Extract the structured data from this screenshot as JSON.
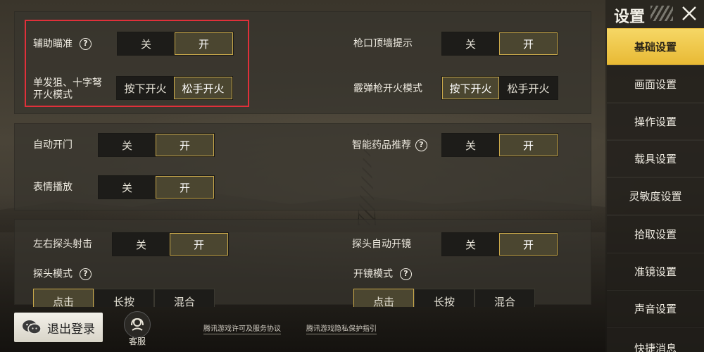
{
  "sidebar": {
    "title": "设置",
    "items": [
      {
        "label": "基础设置",
        "active": true
      },
      {
        "label": "画面设置",
        "active": false
      },
      {
        "label": "操作设置",
        "active": false
      },
      {
        "label": "载具设置",
        "active": false
      },
      {
        "label": "灵敏度设置",
        "active": false
      },
      {
        "label": "拾取设置",
        "active": false
      },
      {
        "label": "准镜设置",
        "active": false
      },
      {
        "label": "声音设置",
        "active": false
      },
      {
        "label": "快捷消息",
        "active": false
      }
    ]
  },
  "panel1": {
    "aim_assist": {
      "label": "辅助瞄准",
      "off": "关",
      "on": "开",
      "selected": "开"
    },
    "single_fire": {
      "label": "单发狙、十字弩开火模式",
      "opt1": "按下开火",
      "opt2": "松手开火",
      "selected": "松手开火"
    },
    "muzzle_wall": {
      "label": "枪口顶墙提示",
      "off": "关",
      "on": "开",
      "selected": "开"
    },
    "shotgun_fire": {
      "label": "霰弹枪开火模式",
      "opt1": "按下开火",
      "opt2": "松手开火",
      "selected": "按下开火"
    }
  },
  "panel2": {
    "auto_door": {
      "label": "自动开门",
      "off": "关",
      "on": "开",
      "selected": "开"
    },
    "emote": {
      "label": "表情播放",
      "off": "关",
      "on": "开",
      "selected": "开"
    },
    "smart_medicine": {
      "label": "智能药品推荐",
      "off": "关",
      "on": "开",
      "selected": "开"
    }
  },
  "panel3": {
    "peek_fire": {
      "label": "左右探头射击",
      "off": "关",
      "on": "开",
      "selected": "开"
    },
    "peek_mode": {
      "label": "探头模式",
      "options": [
        "点击",
        "长按",
        "混合"
      ],
      "selected": "点击"
    },
    "auto_scope": {
      "label": "探头自动开镜",
      "off": "关",
      "on": "开",
      "selected": "开"
    },
    "scope_mode": {
      "label": "开镜模式",
      "options": [
        "点击",
        "长按",
        "混合"
      ],
      "selected": "点击"
    }
  },
  "footer": {
    "logout": "退出登录",
    "service": "客服",
    "license_link": "腾讯游戏许可及服务协议",
    "privacy_link": "腾讯游戏隐私保护指引"
  },
  "colors": {
    "accent_gold": "#c9a84a",
    "sidebar_active": "#f6d765",
    "highlight_red": "#e0303a"
  }
}
